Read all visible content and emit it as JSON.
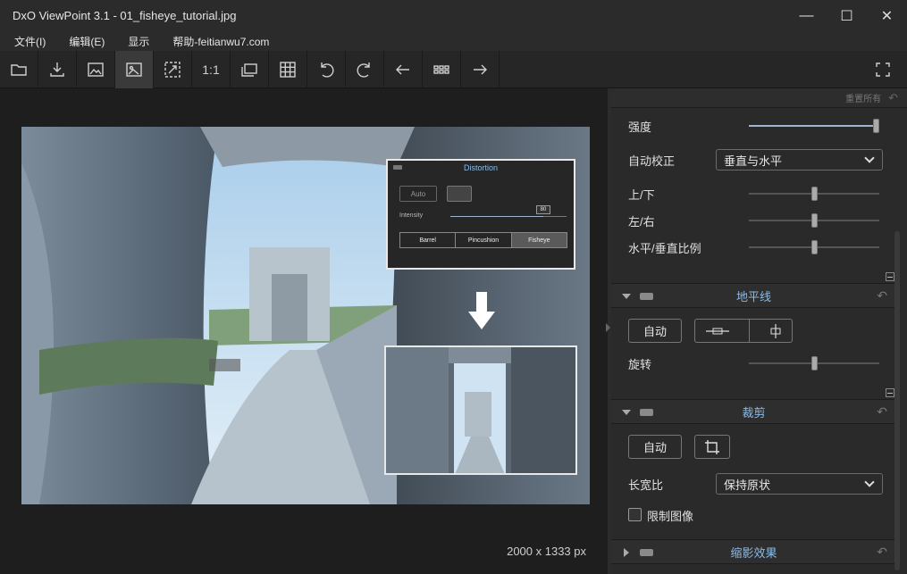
{
  "window": {
    "title": "DxO ViewPoint 3.1 - 01_fisheye_tutorial.jpg",
    "minimize": "—",
    "maximize": "☐",
    "close": "✕"
  },
  "menu": [
    {
      "label": "文件(I)"
    },
    {
      "label": "编辑(E)"
    },
    {
      "label": "显示"
    },
    {
      "label": "帮助-feitianwu7.com"
    }
  ],
  "toolbar": {
    "one_to_one": "1:1"
  },
  "canvas": {
    "dimensions": "2000 x 1333 px"
  },
  "overlay": {
    "title": "Distortion",
    "auto": "Auto",
    "intensity_label": "Intensity",
    "intensity_value": "80",
    "intensity_level": 0.8,
    "modes": [
      "Barrel",
      "Pincushion",
      "Fisheye"
    ]
  },
  "panel": {
    "reset_all": "重置所有",
    "strength_label": "强度",
    "strength_level": 1.0,
    "auto_correct_label": "自动校正",
    "auto_correct_value": "垂直与水平",
    "updown_label": "上/下",
    "updown_level": 0.5,
    "leftright_label": "左/右",
    "leftright_level": 0.5,
    "ratio_label": "水平/垂直比例",
    "ratio_level": 0.5,
    "horizon": {
      "name": "地平线",
      "auto": "自动",
      "rotate_label": "旋转",
      "rotate_level": 0.5
    },
    "crop": {
      "name": "裁剪",
      "auto": "自动",
      "aspect_label": "长宽比",
      "aspect_value": "保持原状",
      "constrain_label": "限制图像"
    },
    "miniature": {
      "name": "缩影效果"
    }
  }
}
